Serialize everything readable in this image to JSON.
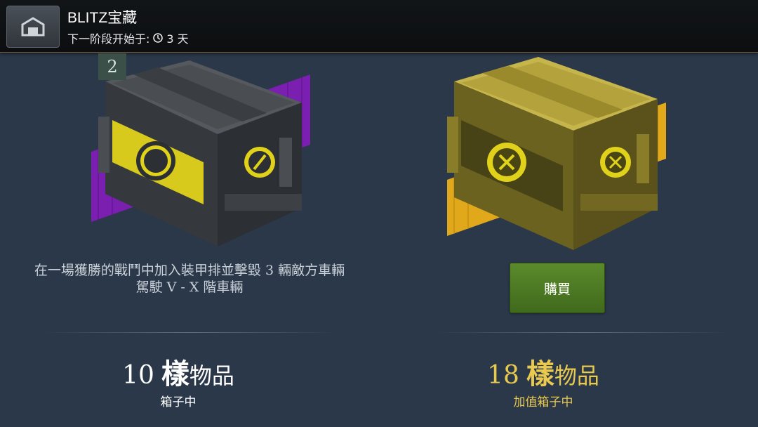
{
  "header": {
    "title": "BLITZ宝藏",
    "subtitle_prefix": "下一阶段开始于:",
    "subtitle_value": "3 天",
    "home_icon": "garage-icon",
    "timer_icon": "timer-icon"
  },
  "crates": [
    {
      "badge": "2",
      "requirement": "在一場獲勝的戰鬥中加入裝甲排並擊毀 3 輛敵方車輛",
      "tier": "駕駛 V - X 階車輛",
      "count": "10",
      "count_word": "樣",
      "count_unit": "物品",
      "caption": "箱子中",
      "stripe_color": "#7a1fb0",
      "crate_color": "#40444a"
    },
    {
      "buy_label": "購買",
      "count": "18",
      "count_word": "樣",
      "count_unit": "物品",
      "caption": "加值箱子中",
      "stripe_color": "#e0a81a",
      "crate_color": "#b9a63a"
    }
  ]
}
